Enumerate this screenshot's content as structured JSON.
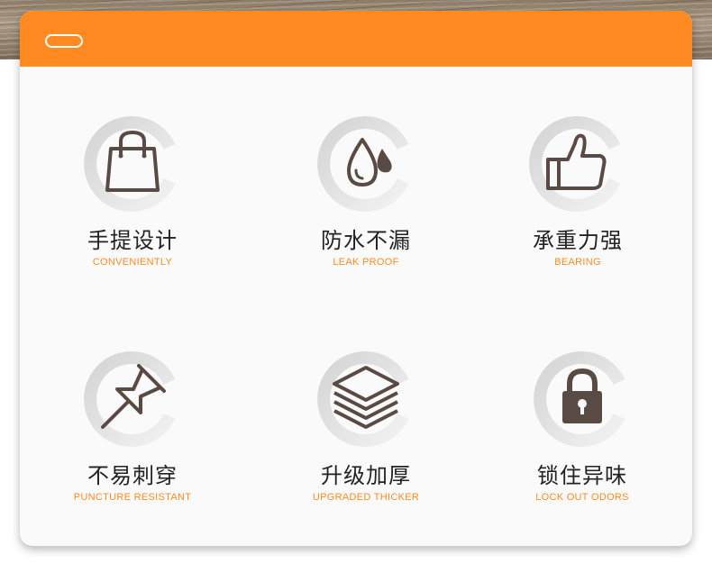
{
  "colors": {
    "accent": "#ff8a22",
    "icon": "#5a4a44",
    "ring_light": "#e6e6e6",
    "ring_dark": "#c9c9c9"
  },
  "features": [
    {
      "icon": "handbag-icon",
      "title": "手提设计",
      "subtitle": "CONVENIENTLY"
    },
    {
      "icon": "water-drop-icon",
      "title": "防水不漏",
      "subtitle": "LEAK PROOF"
    },
    {
      "icon": "thumbs-up-icon",
      "title": "承重力强",
      "subtitle": "BEARING"
    },
    {
      "icon": "pushpin-icon",
      "title": "不易刺穿",
      "subtitle": "PUNCTURE RESISTANT"
    },
    {
      "icon": "layers-icon",
      "title": "升级加厚",
      "subtitle": "UPGRADED THICKER"
    },
    {
      "icon": "padlock-icon",
      "title": "锁住异味",
      "subtitle": "LOCK OUT ODORS"
    }
  ]
}
